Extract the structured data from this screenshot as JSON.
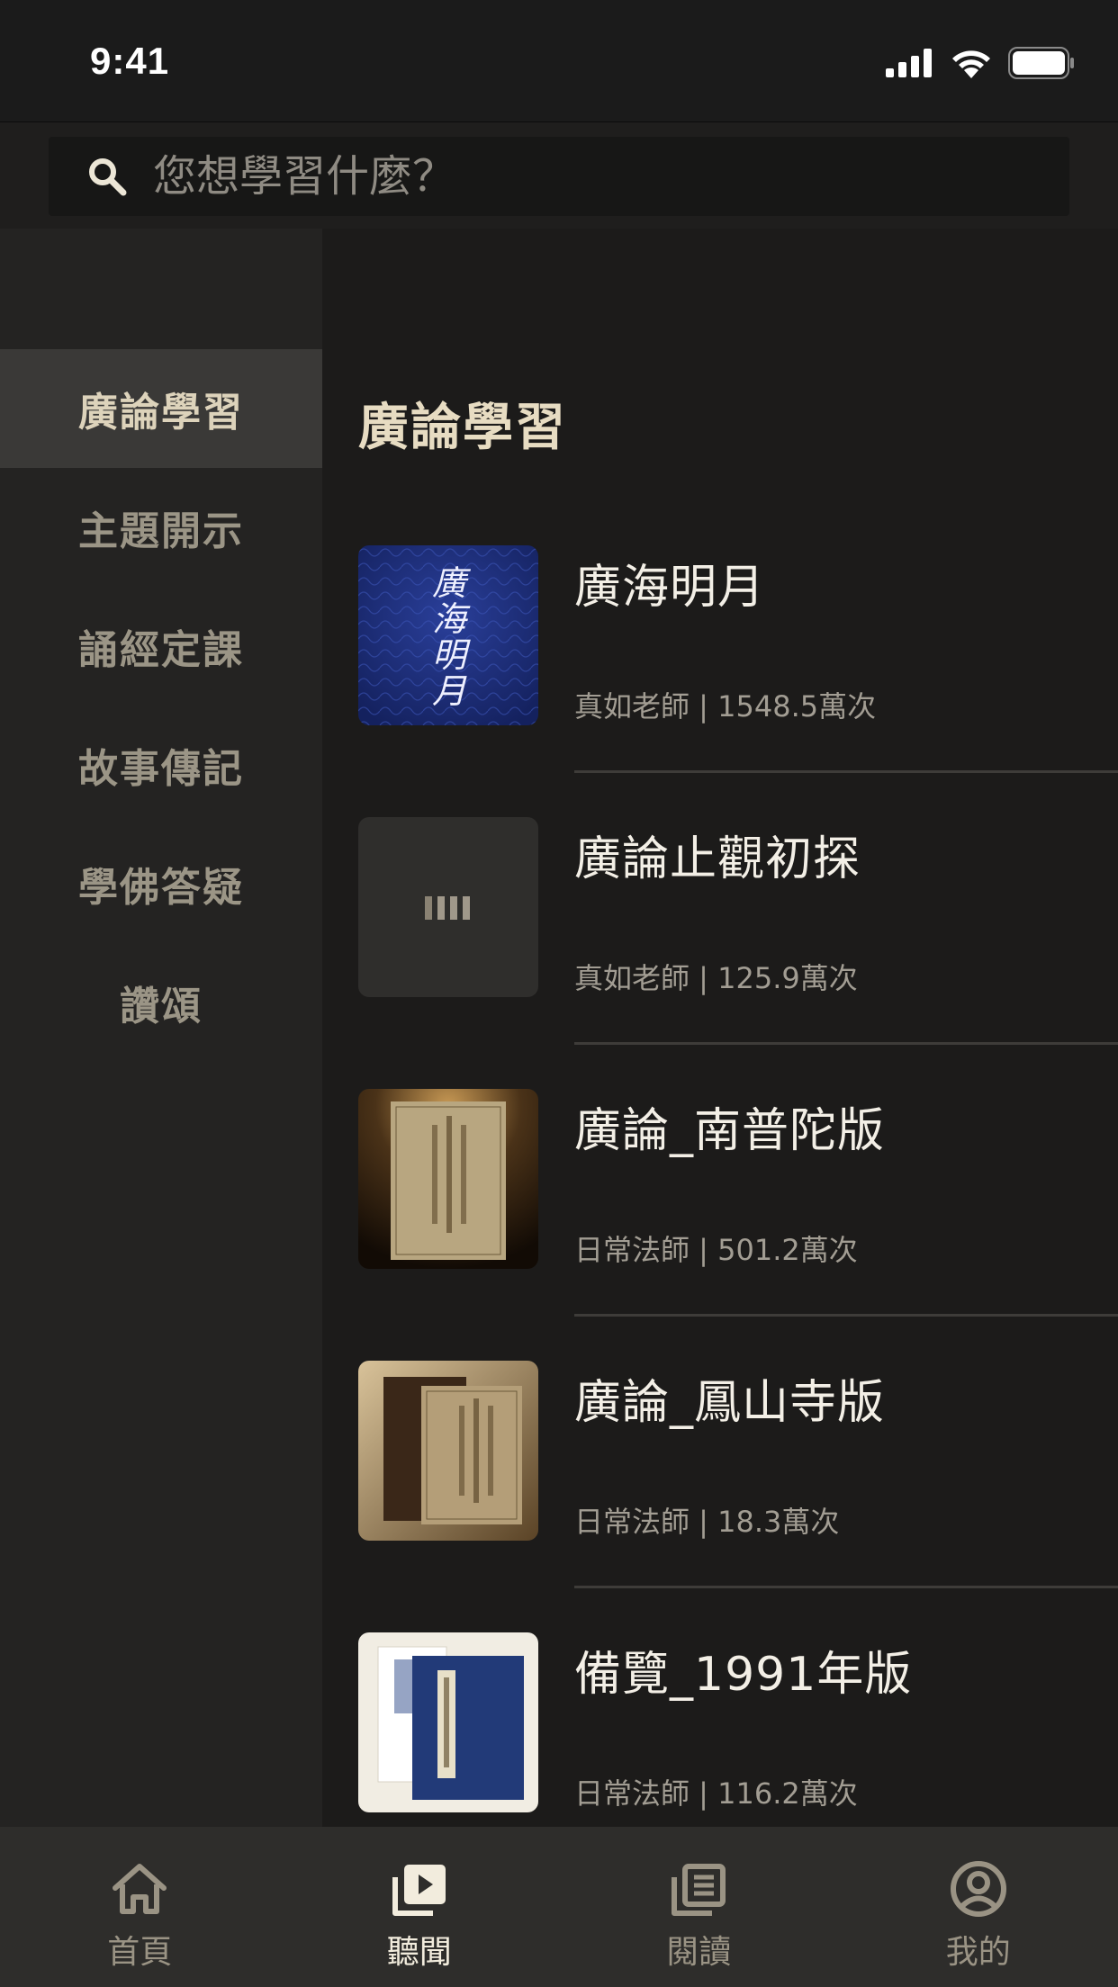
{
  "status_bar": {
    "time": "9:41"
  },
  "search": {
    "placeholder": "您想學習什麼？"
  },
  "sidebar": {
    "items": [
      {
        "label": "廣論學習",
        "active": true
      },
      {
        "label": "主題開示",
        "active": false
      },
      {
        "label": "誦經定課",
        "active": false
      },
      {
        "label": "故事傳記",
        "active": false
      },
      {
        "label": "學佛答疑",
        "active": false
      },
      {
        "label": "讚頌",
        "active": false
      }
    ]
  },
  "content": {
    "section_title": "廣論學習",
    "items": [
      {
        "title": "廣海明月",
        "meta": "真如老師 | 1548.5萬次",
        "thumb_text": "廣海明月"
      },
      {
        "title": "廣論止觀初探",
        "meta": "真如老師 | 125.9萬次"
      },
      {
        "title": "廣論_南普陀版",
        "meta": "日常法師 | 501.2萬次"
      },
      {
        "title": "廣論_鳳山寺版",
        "meta": "日常法師 | 18.3萬次"
      },
      {
        "title": "備覽_1991年版",
        "meta": "日常法師 | 116.2萬次"
      }
    ]
  },
  "tabbar": {
    "tabs": [
      {
        "label": "首頁",
        "icon": "home-icon",
        "active": false
      },
      {
        "label": "聽聞",
        "icon": "play-icon",
        "active": true
      },
      {
        "label": "閱讀",
        "icon": "book-icon",
        "active": false
      },
      {
        "label": "我的",
        "icon": "user-icon",
        "active": false
      }
    ]
  },
  "colors": {
    "background": "#1c1b1a",
    "sidebar": "#242322",
    "sidebar_active": "#3a3937",
    "accent_text": "#e7dcc2",
    "tabbar": "#2e2d2b"
  }
}
